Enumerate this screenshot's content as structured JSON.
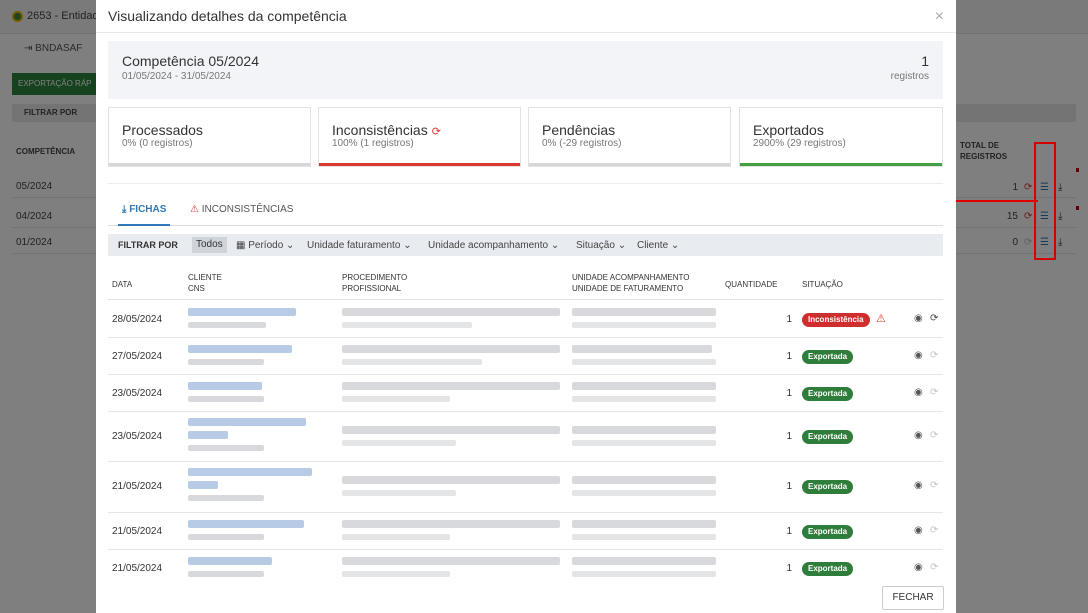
{
  "background": {
    "entity": "2653 - Entidad",
    "bndasaf": "BNDASAF",
    "export_button": "EXPORTAÇÃO RÁP",
    "filter_label": "FILTRAR POR",
    "column_competencia": "COMPETÊNCIA",
    "column_total_1": "TOTAL DE",
    "column_total_2": "REGISTROS",
    "rows": [
      {
        "competencia": "05/2024",
        "total": "1"
      },
      {
        "competencia": "04/2024",
        "total": "15"
      },
      {
        "competencia": "01/2024",
        "total": "0"
      }
    ]
  },
  "modal": {
    "title": "Visualizando detalhes da competência",
    "close_icon": "×",
    "competencia": {
      "title": "Competência 05/2024",
      "range": "01/05/2024 - 31/05/2024",
      "count": "1",
      "count_label": "registros"
    },
    "stats": [
      {
        "title": "Processados",
        "sub": "0% (0 registros)",
        "bar_color": "#d7d7d7"
      },
      {
        "title": "Inconsistências",
        "sub": "100% (1 registros)",
        "bar_color": "#d9392e"
      },
      {
        "title": "Pendências",
        "sub": "0% (-29 registros)",
        "bar_color": "#d7d7d7"
      },
      {
        "title": "Exportados",
        "sub": "2900% (29 registros)",
        "bar_color": "#43a047"
      }
    ],
    "tabs": {
      "fichas": "FICHAS",
      "inconsistencias": "INCONSISTÊNCIAS"
    },
    "filters": {
      "label": "FILTRAR POR",
      "todos": "Todos",
      "periodo": "Período",
      "unidade_faturamento": "Unidade faturamento",
      "unidade_acompanhamento": "Unidade acompanhamento",
      "situacao": "Situação",
      "cliente": "Cliente"
    },
    "columns": {
      "data": "DATA",
      "cliente": "CLIENTE",
      "cns": "CNS",
      "procedimento": "PROCEDIMENTO",
      "profissional": "PROFISSIONAL",
      "unidade_acomp": "UNIDADE ACOMPANHAMENTO",
      "unidade_fat": "UNIDADE DE FATURAMENTO",
      "quantidade": "QUANTIDADE",
      "situacao": "SITUAÇÃO"
    },
    "rows": [
      {
        "data": "28/05/2024",
        "quantidade": "1",
        "situacao": "Inconsistência",
        "status": "error"
      },
      {
        "data": "27/05/2024",
        "quantidade": "1",
        "situacao": "Exportada",
        "status": "ok"
      },
      {
        "data": "23/05/2024",
        "quantidade": "1",
        "situacao": "Exportada",
        "status": "ok"
      },
      {
        "data": "23/05/2024",
        "quantidade": "1",
        "situacao": "Exportada",
        "status": "ok"
      },
      {
        "data": "21/05/2024",
        "quantidade": "1",
        "situacao": "Exportada",
        "status": "ok"
      },
      {
        "data": "21/05/2024",
        "quantidade": "1",
        "situacao": "Exportada",
        "status": "ok"
      },
      {
        "data": "21/05/2024",
        "quantidade": "1",
        "situacao": "Exportada",
        "status": "ok"
      }
    ],
    "close_button": "FECHAR"
  }
}
